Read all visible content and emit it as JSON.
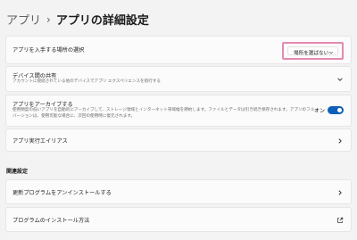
{
  "breadcrumb": {
    "parent": "アプリ",
    "separator": "›",
    "current": "アプリの詳細設定"
  },
  "app_source": {
    "title": "アプリを入手する場所の選択",
    "dropdown_value": "場所を選ばない"
  },
  "cross_device": {
    "title": "デバイス間の共有",
    "description": "アカウントに接続されている他のデバイスでアプリ エクスペリエンスを続行する"
  },
  "archive_apps": {
    "title": "アプリをアーカイブする",
    "description_line1": "使用頻度の低いアプリを自動的にアーカイブして、ストレージ領域とインターネット帯域幅を節約します。ファイルとデータは引き続き保存されます。アプリのフル",
    "description_line2": "バージョンは、使用可能な場合に、次回の使用時に復元されます。",
    "toggle_label": "オン"
  },
  "execution_aliases": {
    "title": "アプリ実行エイリアス"
  },
  "related": {
    "heading": "関連設定",
    "items": [
      {
        "title": "更新プログラムをアンインストールする"
      },
      {
        "title": "プログラムのインストール方法"
      }
    ]
  },
  "colors": {
    "accent": "#0f5fb6",
    "highlight": "#e48ab0",
    "background": "#f3f3f3",
    "card": "#fbfbfb"
  }
}
